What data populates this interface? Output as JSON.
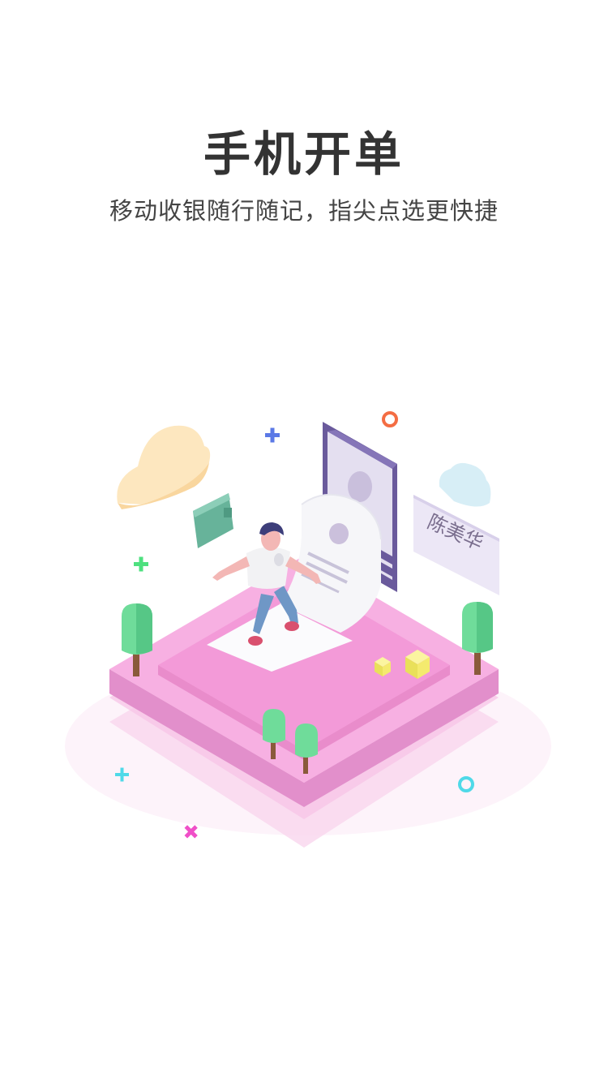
{
  "screen": {
    "title": "手机开单",
    "subtitle": "移动收银随行随记，指尖点选更快捷"
  },
  "illustration": {
    "card_name": "陈美华",
    "colors": {
      "platform": "#f5a8de",
      "platform_side": "#e492cd",
      "tree": "#6fdc9a",
      "phone_frame": "#6a5a9c",
      "cloud_left": "#fde7bf",
      "cloud_right": "#d7eef6"
    }
  }
}
